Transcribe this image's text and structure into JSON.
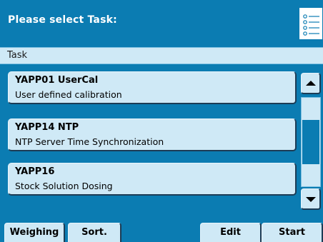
{
  "header": {
    "title": "Please select Task:",
    "menu_icon": "list-menu-icon"
  },
  "subheader": {
    "label": "Task"
  },
  "tasks": [
    {
      "name": "YAPP01 UserCal",
      "description": "User defined calibration"
    },
    {
      "name": "YAPP14 NTP",
      "description": "NTP Server Time Synchronization"
    },
    {
      "name": "YAPP16",
      "description": "Stock Solution Dosing"
    }
  ],
  "scrollbar": {
    "up_icon": "arrow-up-icon",
    "down_icon": "arrow-down-icon",
    "position_fraction": 0.5,
    "visible_fraction": 0.5
  },
  "footer": {
    "weighing": "Weighing",
    "sort": "Sort.",
    "edit": "Edit",
    "start": "Start"
  },
  "colors": {
    "accent": "#0b7cb2",
    "button": "#cfe9f6",
    "shadow": "#1c3c55"
  }
}
